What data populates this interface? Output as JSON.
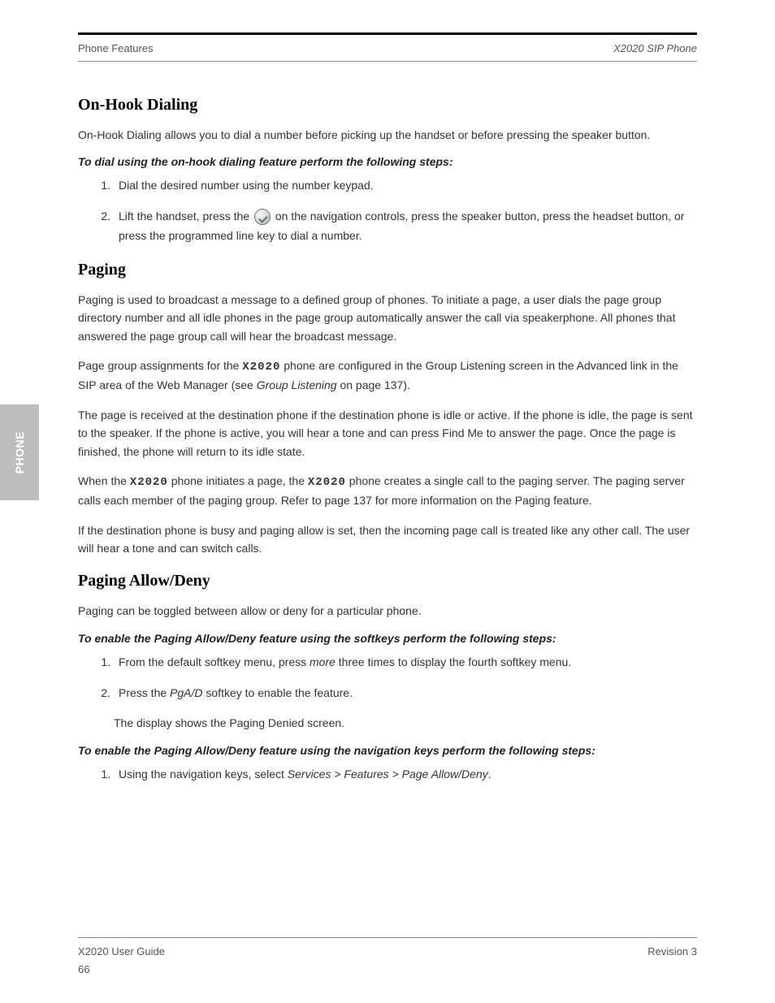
{
  "header": {
    "left": "Phone Features",
    "right": "X2020 SIP Phone"
  },
  "sections": [
    {
      "title": "On-Hook Dialing",
      "intro": "On-Hook Dialing allows you to dial a number before picking up the handset or before pressing the speaker button.",
      "procedure": "To dial using the on-hook dialing feature perform the following steps:",
      "steps": [
        "Dial the desired number using the number keypad.",
        {
          "prefix": "Lift the handset, press the ",
          "icon": "ok-icon",
          "suffix": " on the navigation controls, press the speaker button, press the headset button, or press the programmed line key to dial a number."
        }
      ]
    },
    {
      "title": "Paging",
      "text": [
        "Paging is used to broadcast a message to a defined group of phones. To initiate a page, a user dials the page group directory number and all idle phones in the page group automatically answer the call via speakerphone. All phones that answered the page group call will hear the broadcast message.",
        {
          "segments": [
            "Page group assignments for the ",
            "X2020",
            " phone are configured in the Group Listening screen in the Advanced link in the SIP area of the Web Manager (see ",
            "Group Listening",
            " on page ",
            "137",
            ")."
          ]
        },
        "The page is received at the destination phone if the destination phone is idle or active. If the phone is idle, the page is sent to the speaker. If the phone is active, you will hear a tone and can press Find Me to answer the page. Once the page is finished, the phone will return to its idle state.",
        {
          "segments": [
            "When the ",
            "X2020",
            " phone initiates a page, the ",
            "X2020",
            " phone creates a single call to the paging server. The paging server calls each member of the paging group. Refer to page ",
            "137",
            " for more information on the Paging feature."
          ]
        },
        "If the destination phone is busy and paging allow is set, then the incoming page call is treated like any other call. The user will hear a tone and can switch calls."
      ]
    },
    {
      "title": "Paging Allow/Deny",
      "text1": "Paging can be toggled between allow or deny for a particular phone.",
      "procedure": "To enable the Paging Allow/Deny feature using the softkeys perform the following steps:",
      "steps": [
        {
          "segments": [
            "From the default softkey menu, press ",
            "more",
            " three times to display the fourth softkey menu."
          ]
        },
        {
          "segments": [
            "Press the ",
            "PgA/D",
            " softkey to enable the feature."
          ]
        }
      ],
      "text2": "The display shows the Paging Denied screen.",
      "procedure2": "To enable the Paging Allow/Deny feature using the navigation keys perform the following steps:",
      "steps2": [
        {
          "segments": [
            "Using the navigation keys, select ",
            "Services > Features > Page Allow/Deny",
            "."
          ]
        }
      ]
    }
  ],
  "footer": {
    "left": "66",
    "left2": "X2020 User Guide",
    "right": "Revision 3"
  }
}
